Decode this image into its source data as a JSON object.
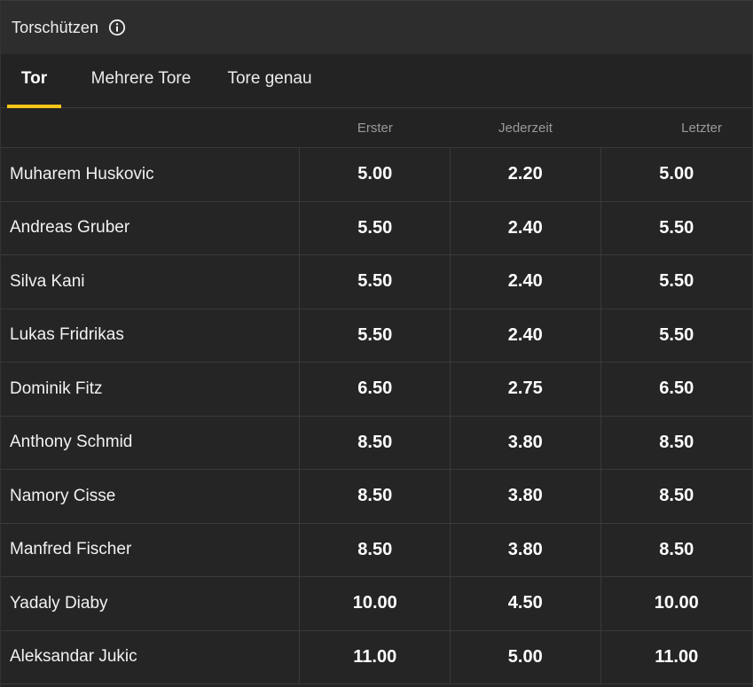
{
  "header": {
    "title": "Torschützen",
    "info_icon": "info-icon"
  },
  "tabs": [
    {
      "label": "Tor",
      "active": true
    },
    {
      "label": "Mehrere Tore",
      "active": false
    },
    {
      "label": "Tore genau",
      "active": false
    }
  ],
  "columns": [
    "Erster",
    "Jederzeit",
    "Letzter"
  ],
  "rows": [
    {
      "name": "Muharem Huskovic",
      "odds": [
        "5.00",
        "2.20",
        "5.00"
      ]
    },
    {
      "name": "Andreas Gruber",
      "odds": [
        "5.50",
        "2.40",
        "5.50"
      ]
    },
    {
      "name": "Silva Kani",
      "odds": [
        "5.50",
        "2.40",
        "5.50"
      ]
    },
    {
      "name": "Lukas Fridrikas",
      "odds": [
        "5.50",
        "2.40",
        "5.50"
      ]
    },
    {
      "name": "Dominik Fitz",
      "odds": [
        "6.50",
        "2.75",
        "6.50"
      ]
    },
    {
      "name": "Anthony Schmid",
      "odds": [
        "8.50",
        "3.80",
        "8.50"
      ]
    },
    {
      "name": "Namory Cisse",
      "odds": [
        "8.50",
        "3.80",
        "8.50"
      ]
    },
    {
      "name": "Manfred Fischer",
      "odds": [
        "8.50",
        "3.80",
        "8.50"
      ]
    },
    {
      "name": "Yadaly Diaby",
      "odds": [
        "10.00",
        "4.50",
        "10.00"
      ]
    },
    {
      "name": "Aleksandar Jukic",
      "odds": [
        "11.00",
        "5.00",
        "11.00"
      ]
    }
  ],
  "colors": {
    "accent": "#f5c518",
    "background": "#252525",
    "header_background": "#2d2d2d"
  }
}
